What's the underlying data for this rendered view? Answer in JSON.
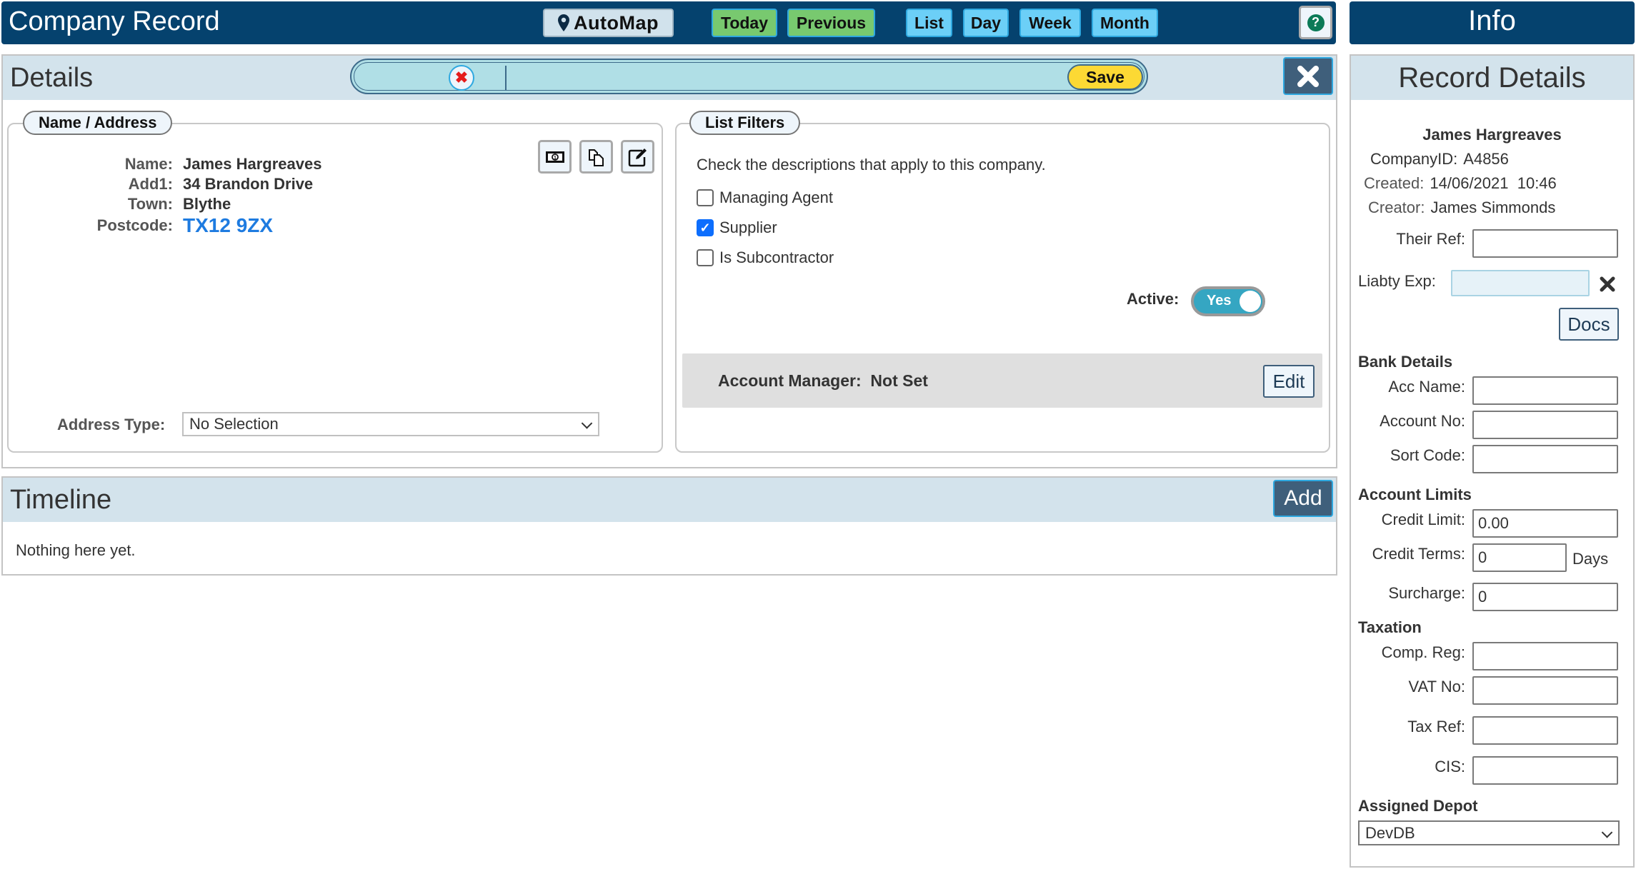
{
  "topbar": {
    "title": "Company Record",
    "automap_label": "AutoMap",
    "buttons": {
      "today": "Today",
      "previous": "Previous",
      "list": "List",
      "day": "Day",
      "week": "Week",
      "month": "Month"
    },
    "help_icon": "?"
  },
  "info_header": {
    "title": "Info"
  },
  "details": {
    "title": "Details",
    "search": {
      "value": "",
      "placeholder": ""
    },
    "save_label": "Save",
    "name_address": {
      "legend": "Name / Address",
      "rows": [
        {
          "label": "Name:",
          "value": "James Hargreaves"
        },
        {
          "label": "Add1:",
          "value": "34 Brandon Drive"
        },
        {
          "label": "Town:",
          "value": "Blythe"
        },
        {
          "label": "Postcode:",
          "value": "TX12 9ZX"
        }
      ],
      "address_type_label": "Address Type:",
      "address_type_value": "No Selection"
    },
    "list_filters": {
      "legend": "List Filters",
      "description": "Check the descriptions that apply to this company.",
      "options": [
        {
          "label": "Managing Agent",
          "checked": false
        },
        {
          "label": "Supplier",
          "checked": true
        },
        {
          "label": "Is Subcontractor",
          "checked": false
        }
      ],
      "active_label": "Active:",
      "active_value": "Yes",
      "account_manager_label": "Account Manager:",
      "account_manager_value": "Not Set",
      "edit_label": "Edit"
    }
  },
  "timeline": {
    "title": "Timeline",
    "add_label": "Add",
    "empty_text": "Nothing here yet."
  },
  "info": {
    "title": "Record Details",
    "name": "James Hargreaves",
    "company_id_label": "CompanyID:",
    "company_id": "A4856",
    "created_label": "Created:",
    "created": "14/06/2021  10:46",
    "creator_label": "Creator:",
    "creator": "James Simmonds",
    "their_ref_label": "Their Ref:",
    "their_ref": "",
    "liability_label": "Liabty Exp:",
    "liability_value": "",
    "docs_label": "Docs",
    "bank_heading": "Bank Details",
    "acc_name_label": "Acc Name:",
    "acc_name": "",
    "account_no_label": "Account No:",
    "account_no": "",
    "sort_code_label": "Sort Code:",
    "sort_code": "",
    "limits_heading": "Account Limits",
    "credit_limit_label": "Credit Limit:",
    "credit_limit": "0.00",
    "credit_terms_label": "Credit Terms:",
    "credit_terms": "0",
    "days_label": "Days",
    "surcharge_label": "Surcharge:",
    "surcharge": "0",
    "taxation_heading": "Taxation",
    "comp_reg_label": "Comp. Reg:",
    "comp_reg": "",
    "vat_no_label": "VAT No:",
    "vat_no": "",
    "tax_ref_label": "Tax Ref:",
    "tax_ref": "",
    "cis_label": "CIS:",
    "cis": "",
    "depot_heading": "Assigned Depot",
    "depot_value": "DevDB"
  },
  "colors": {
    "topbar_bg": "#05426e",
    "panel_header_bg": "#d3e3ec",
    "today_previous_bg": "#78c96f",
    "view_buttons_bg": "#6ccff7",
    "save_bg": "#fcd934",
    "postcode_link": "#1e7be0",
    "toggle_on": "#35a6c2",
    "dark_button": "#3f5f7b"
  }
}
